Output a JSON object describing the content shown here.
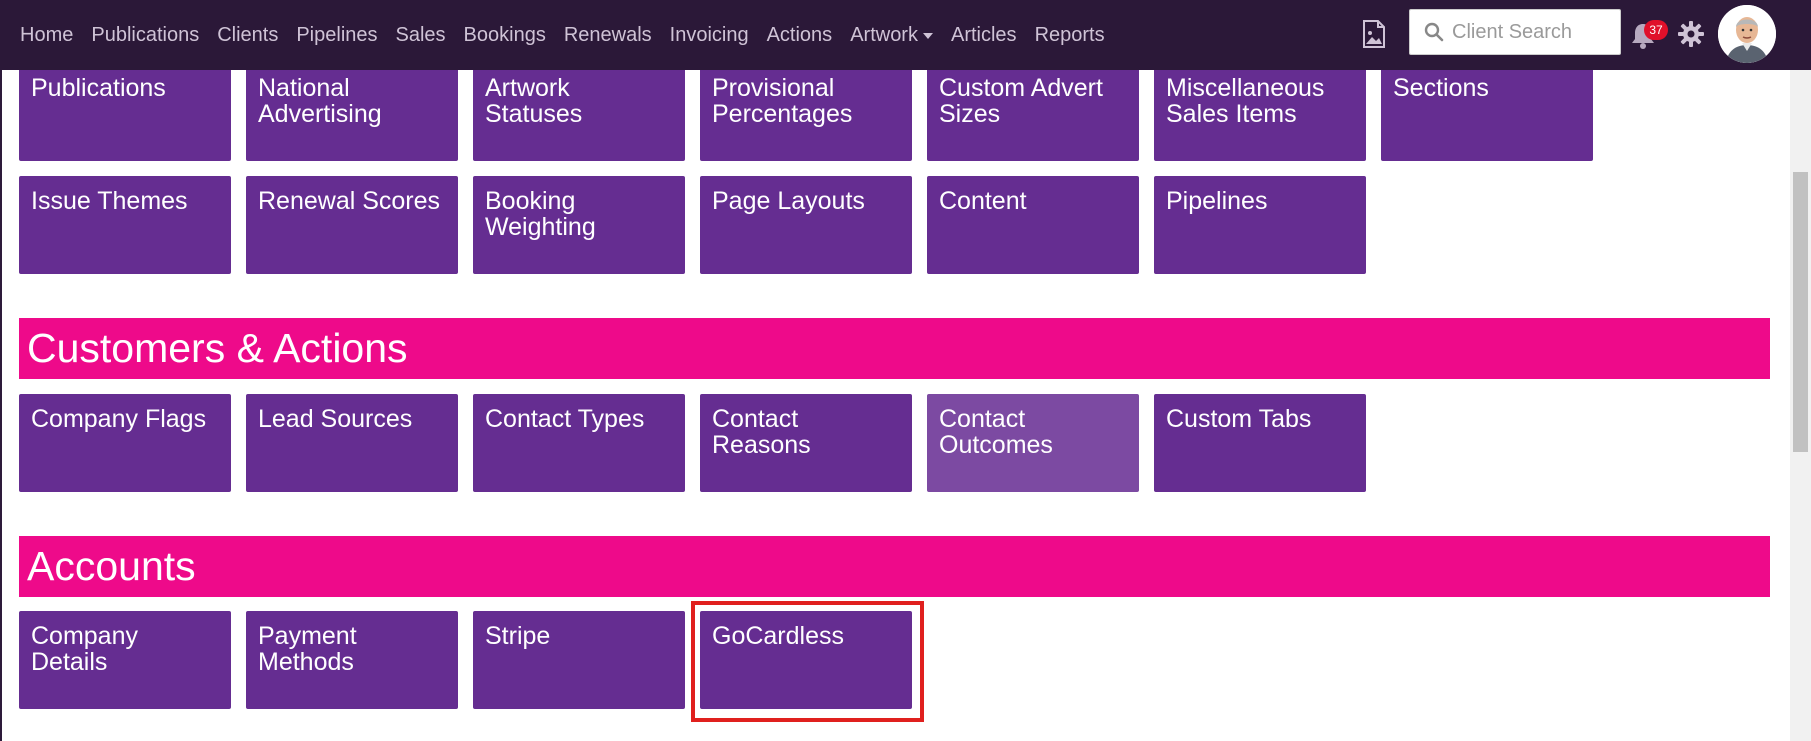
{
  "nav": {
    "items": [
      "Home",
      "Publications",
      "Clients",
      "Pipelines",
      "Sales",
      "Bookings",
      "Renewals",
      "Invoicing",
      "Actions",
      "Artwork",
      "Articles",
      "Reports"
    ],
    "search_placeholder": "Client Search",
    "notification_count": "37"
  },
  "settings_rows": {
    "row1": [
      "Publications",
      "National Advertising",
      "Artwork Statuses",
      "Provisional Percentages",
      "Custom Advert Sizes",
      "Miscellaneous Sales Items",
      "Sections"
    ],
    "row2": [
      "Issue Themes",
      "Renewal Scores",
      "Booking Weighting",
      "Page Layouts",
      "Content",
      "Pipelines"
    ]
  },
  "customers_actions": {
    "title": "Customers & Actions",
    "tiles": [
      "Company Flags",
      "Lead Sources",
      "Contact Types",
      "Contact Reasons",
      "Contact Outcomes",
      "Custom Tabs"
    ]
  },
  "accounts": {
    "title": "Accounts",
    "tiles": [
      "Company Details",
      "Payment Methods",
      "Stripe",
      "GoCardless"
    ]
  },
  "colors": {
    "topbar": "#2b1838",
    "tile": "#652d91",
    "tile_hover": "#7c4aa2",
    "section_band": "#ee0a8a",
    "highlight_border": "#e0201e"
  }
}
